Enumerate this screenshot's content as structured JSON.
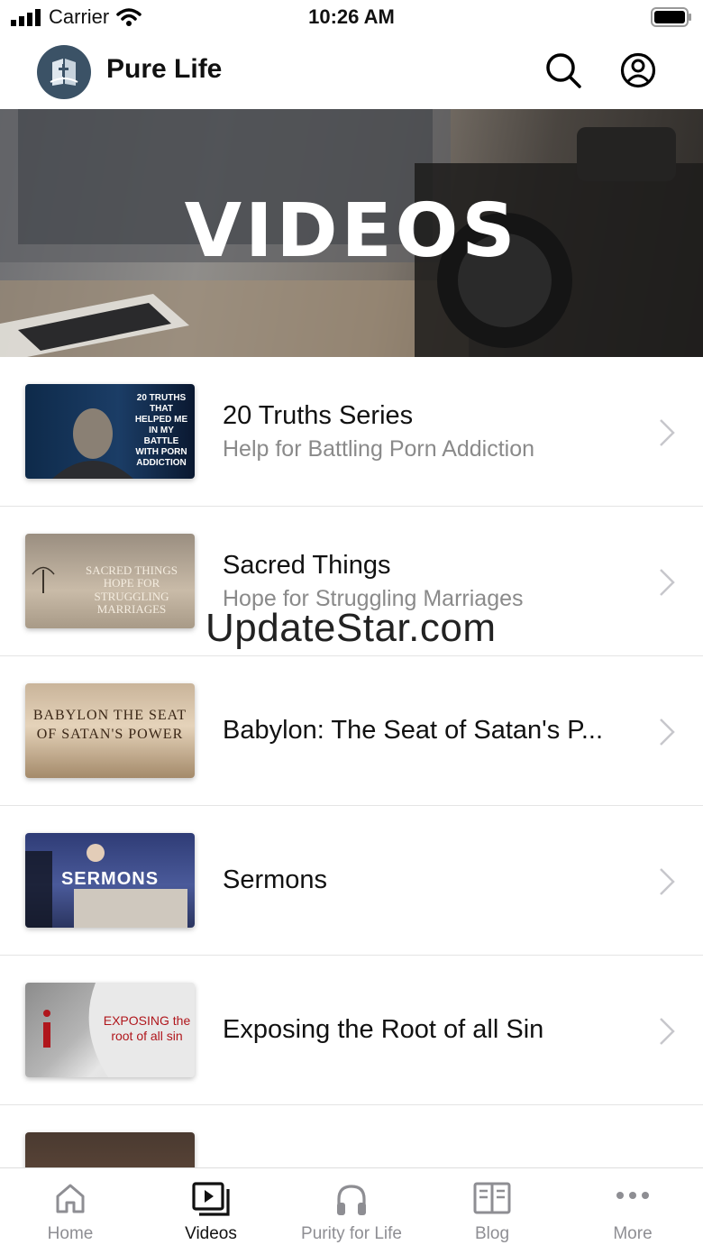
{
  "status": {
    "carrier": "Carrier",
    "time": "10:26 AM"
  },
  "app": {
    "title": "Pure Life"
  },
  "hero": {
    "title": "VIDEOS"
  },
  "items": [
    {
      "title": "20 Truths Series",
      "subtitle": "Help for Battling Porn Addiction",
      "thumb_text": "20 TRUTHS THAT HELPED ME IN MY BATTLE WITH PORN ADDICTION"
    },
    {
      "title": "Sacred Things",
      "subtitle": "Hope for Struggling Marriages",
      "thumb_text": "SACRED THINGS HOPE FOR STRUGGLING MARRIAGES"
    },
    {
      "title": "Babylon: The Seat of Satan's P...",
      "subtitle": "",
      "thumb_text": "BABYLON THE SEAT OF SATAN'S POWER"
    },
    {
      "title": "Sermons",
      "subtitle": "",
      "thumb_text": "SERMONS"
    },
    {
      "title": "Exposing the Root of all Sin",
      "subtitle": "",
      "thumb_text": "EXPOSING the root of all sin"
    }
  ],
  "watermark": "UpdateStar.com",
  "tabs": [
    {
      "label": "Home",
      "icon": "home-icon",
      "active": false
    },
    {
      "label": "Videos",
      "icon": "video-icon",
      "active": true
    },
    {
      "label": "Purity for Life",
      "icon": "headphones-icon",
      "active": false
    },
    {
      "label": "Blog",
      "icon": "book-icon",
      "active": false
    },
    {
      "label": "More",
      "icon": "more-icon",
      "active": false
    }
  ],
  "colors": {
    "active_tab": "#111111",
    "inactive_tab": "#8e8e93",
    "logo_bg": "#3b5266"
  }
}
